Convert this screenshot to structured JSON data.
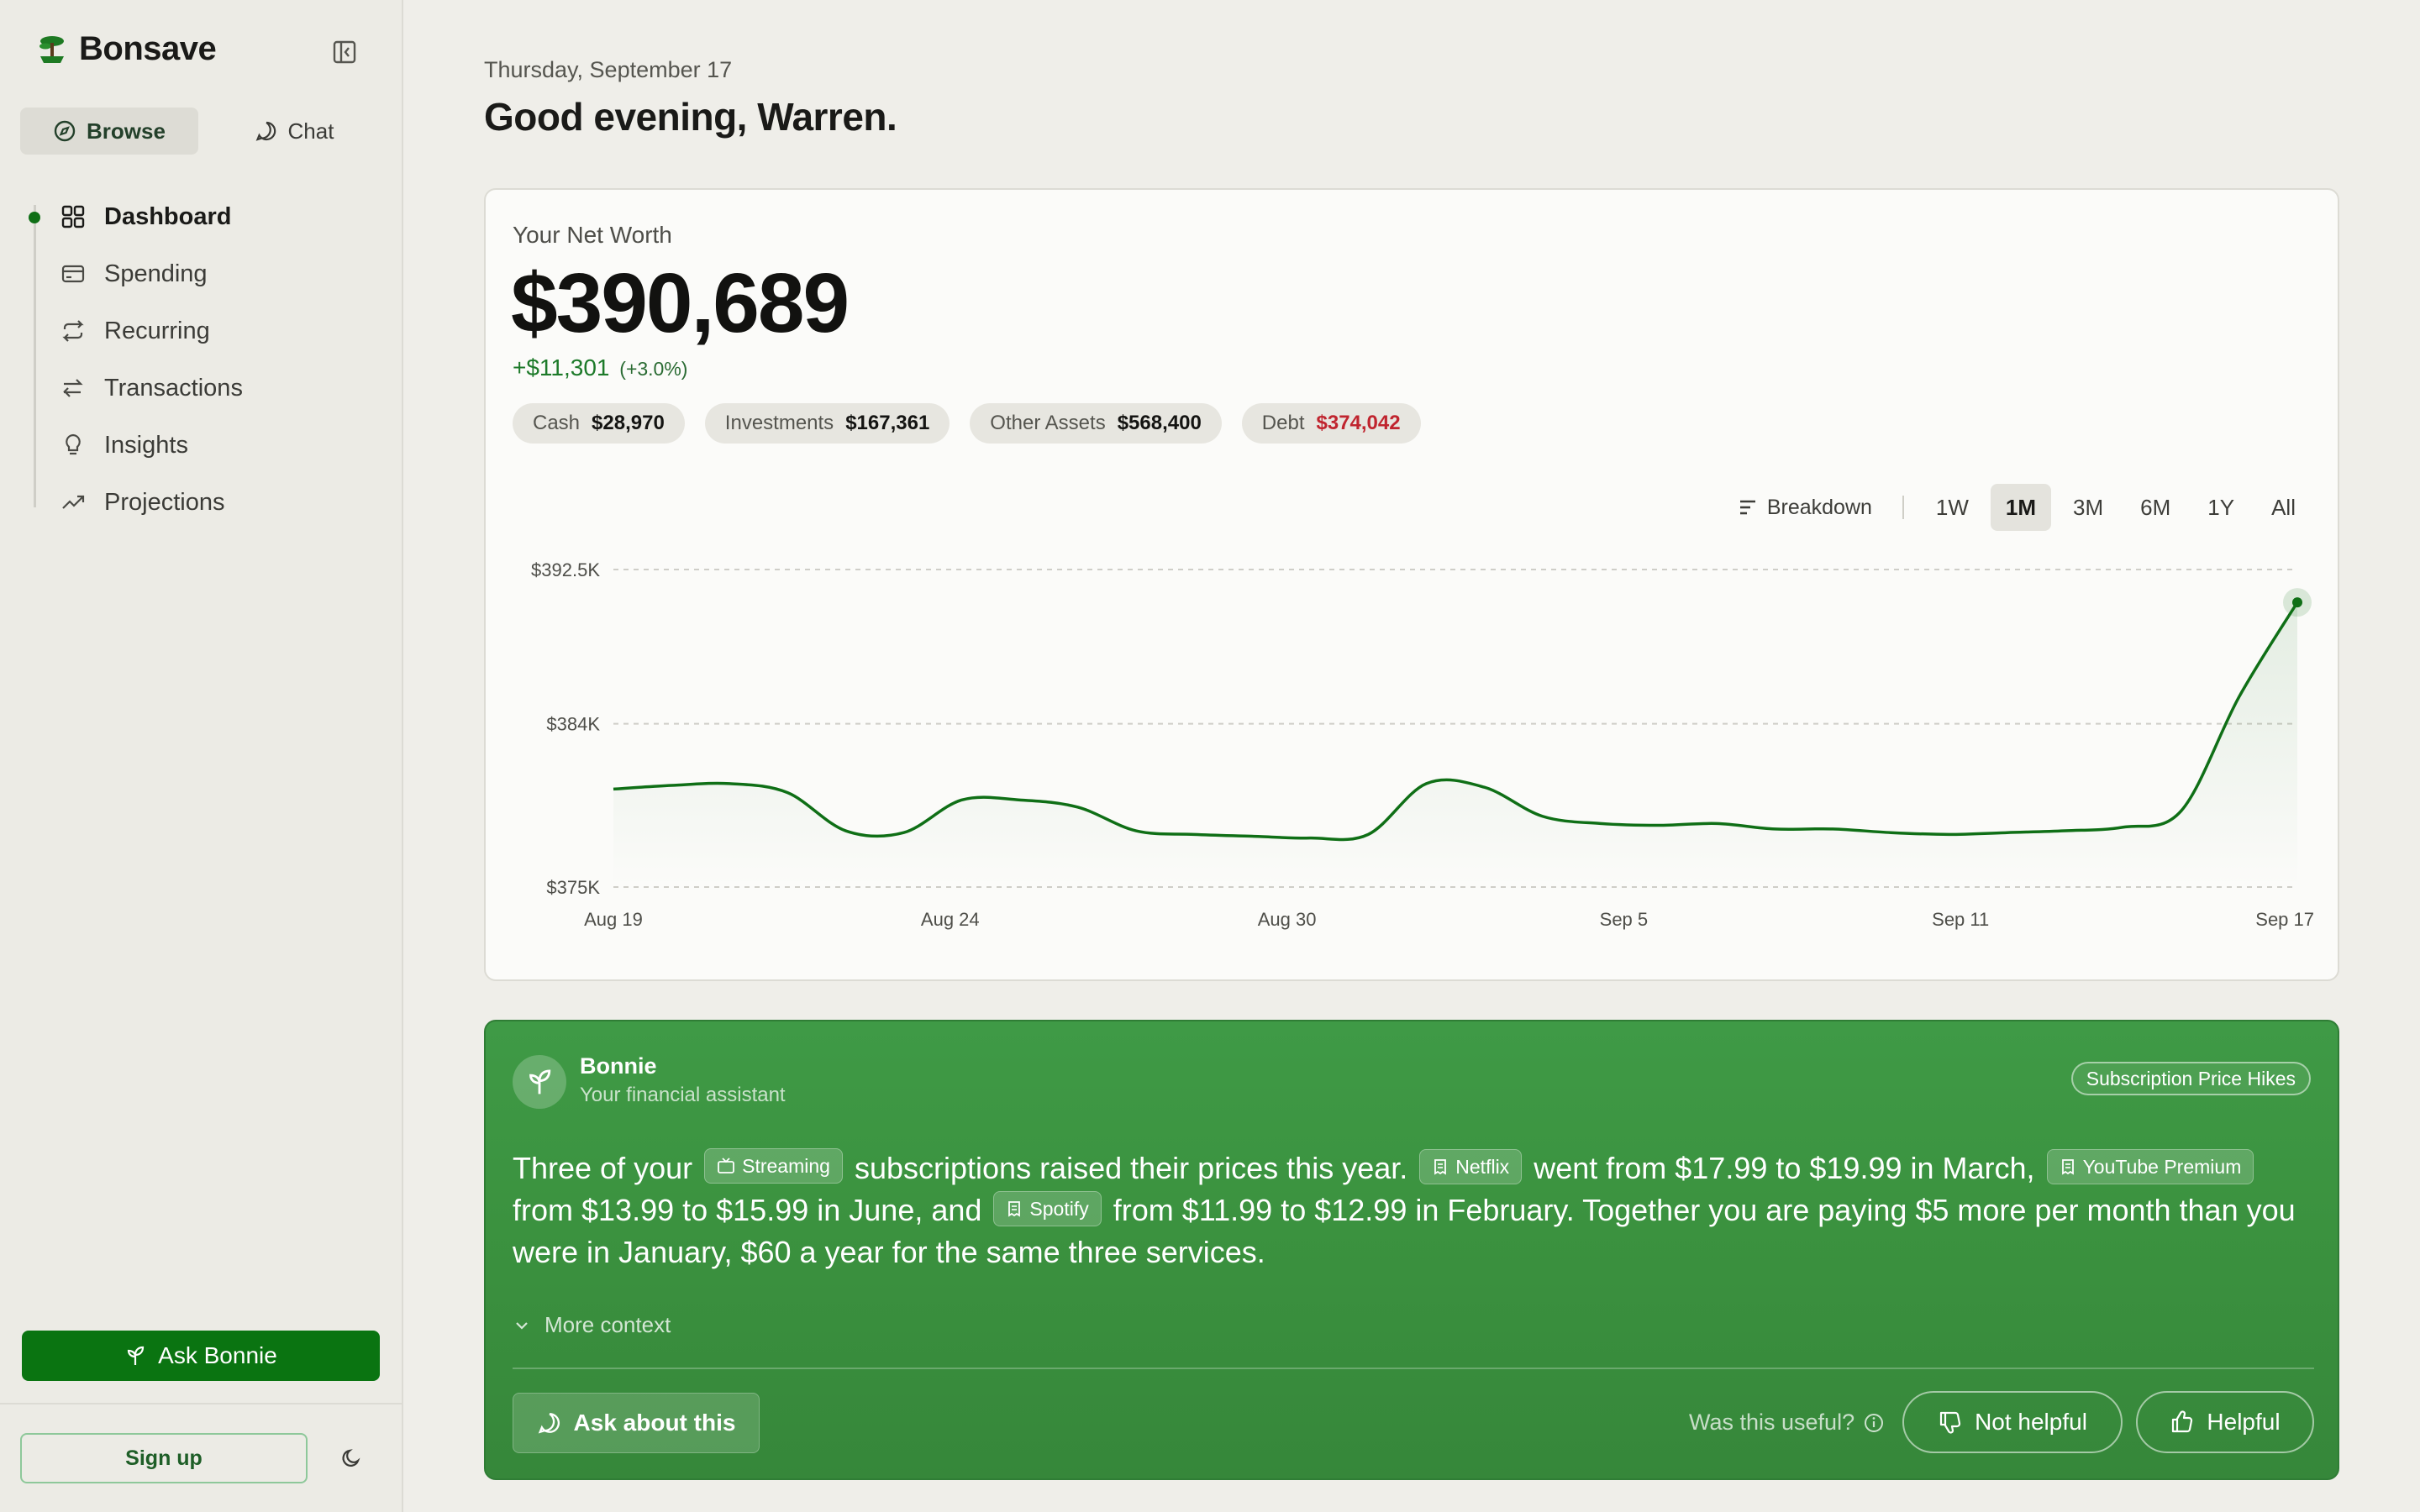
{
  "app": {
    "name": "Bonsave"
  },
  "sidebar": {
    "modes": [
      {
        "label": "Browse",
        "icon": "compass-icon",
        "active": true
      },
      {
        "label": "Chat",
        "icon": "chat-bubble-icon",
        "active": false
      }
    ],
    "nav": [
      {
        "label": "Dashboard",
        "icon": "grid-icon",
        "active": true
      },
      {
        "label": "Spending",
        "icon": "card-icon",
        "active": false
      },
      {
        "label": "Recurring",
        "icon": "repeat-icon",
        "active": false
      },
      {
        "label": "Transactions",
        "icon": "arrows-swap-icon",
        "active": false
      },
      {
        "label": "Insights",
        "icon": "lightbulb-icon",
        "active": false
      },
      {
        "label": "Projections",
        "icon": "trend-up-icon",
        "active": false
      }
    ],
    "ask_bonnie": "Ask Bonnie",
    "sign_up": "Sign up"
  },
  "header": {
    "date": "Thursday, September 17",
    "greeting": "Good evening, Warren."
  },
  "net_worth": {
    "label": "Your Net Worth",
    "value": "$390,689",
    "change": "+$11,301",
    "change_pct": "(+3.0%)",
    "chips": [
      {
        "label": "Cash",
        "value": "$28,970"
      },
      {
        "label": "Investments",
        "value": "$167,361"
      },
      {
        "label": "Other Assets",
        "value": "$568,400"
      },
      {
        "label": "Debt",
        "value": "$374,042"
      }
    ],
    "breakdown_label": "Breakdown",
    "ranges": [
      "1W",
      "1M",
      "3M",
      "6M",
      "1Y",
      "All"
    ],
    "active_range": "1M",
    "colors": {
      "line": "#0f6f16",
      "positive": "#1d7a2a",
      "debt": "#c0252f"
    }
  },
  "chart_data": {
    "type": "line",
    "series": [
      {
        "values": [
          380.4,
          380.6,
          380.7,
          380.2,
          378.1,
          378.0,
          379.8,
          379.8,
          379.4,
          378.1,
          377.9,
          377.8,
          377.7,
          377.9,
          380.7,
          380.5,
          378.9,
          378.5,
          378.4,
          378.5,
          378.2,
          378.2,
          378.0,
          377.9,
          378.0,
          378.1,
          378.3,
          379.2,
          385.5,
          390.689
        ]
      }
    ],
    "x_ticks": [
      "Aug 19",
      "Aug 24",
      "Aug 30",
      "Sep 5",
      "Sep 11",
      "Sep 17"
    ],
    "y_ticks": [
      {
        "value": 375,
        "label": "$375K"
      },
      {
        "value": 384,
        "label": "$384K"
      },
      {
        "value": 392.5,
        "label": "$392.5K"
      }
    ],
    "ylim": [
      375,
      392.5
    ],
    "grid": true
  },
  "bonnie": {
    "name": "Bonnie",
    "subtitle": "Your financial assistant",
    "topic": "Subscription Price Hikes",
    "insight": {
      "t1": "Three of your",
      "tag_streaming": "Streaming",
      "t2": "subscriptions raised their prices this year.",
      "tag_netflix": "Netflix",
      "t3": "went from $17.99 to $19.99 in March,",
      "tag_youtube": "YouTube Premium",
      "t4": "from $13.99 to $15.99 in June, and",
      "tag_spotify": "Spotify",
      "t5": "from $11.99 to $12.99 in February. Together you are paying $5 more per month than you were in January, $60 a year for the same three services."
    },
    "more_context": "More context",
    "ask_about": "Ask about this",
    "useful_q": "Was this useful?",
    "not_helpful": "Not helpful",
    "helpful": "Helpful"
  }
}
